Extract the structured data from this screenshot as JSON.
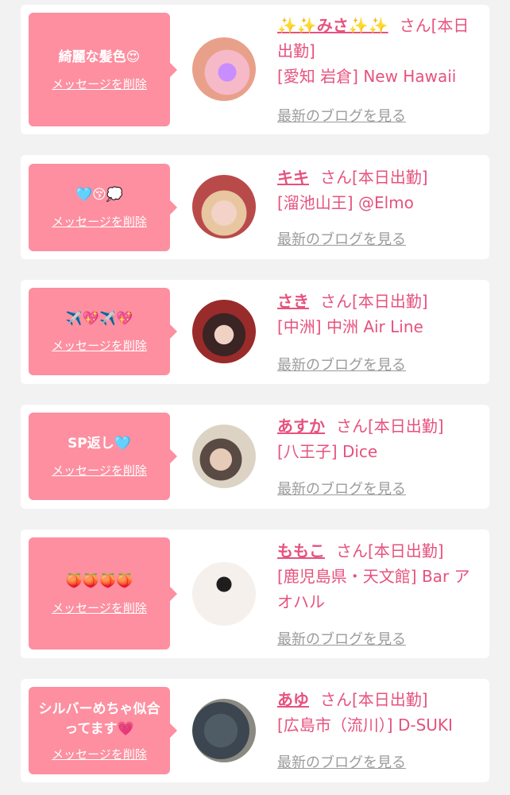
{
  "delete_label": "メッセージを削除",
  "blog_label": "最新のブログを見る",
  "cards": [
    {
      "message": "綺麗な髪色😍",
      "name": "✨✨みさ✨✨",
      "status": "さん[本日出勤]",
      "location": "[愛知 岩倉] New Hawaii"
    },
    {
      "message": "🩵😚💭",
      "name": "キキ",
      "status": "さん[本日出勤]",
      "location": "[溜池山王] @Elmo"
    },
    {
      "message": "✈️💖✈️💖",
      "name": "さき",
      "status": "さん[本日出勤]",
      "location": "[中洲] 中洲 Air Line"
    },
    {
      "message": "SP返し🩵",
      "name": "あすか",
      "status": "さん[本日出勤]",
      "location": "[八王子] Dice"
    },
    {
      "message": "🍑🍑🍑🍑",
      "name": "ももこ",
      "status": "さん[本日出勤]",
      "location": "[鹿児島県・天文館] Bar アオハル"
    },
    {
      "message": "シルバーめちゃ似合ってます💗",
      "name": "あゆ",
      "status": "さん[本日出勤]",
      "location": "[広島市（流川）] D-SUKI"
    }
  ],
  "colors": {
    "bubble": "#fd8fa0",
    "name": "#e6527e",
    "link_gray": "#9b9b9b",
    "background": "#f2f2f2"
  }
}
